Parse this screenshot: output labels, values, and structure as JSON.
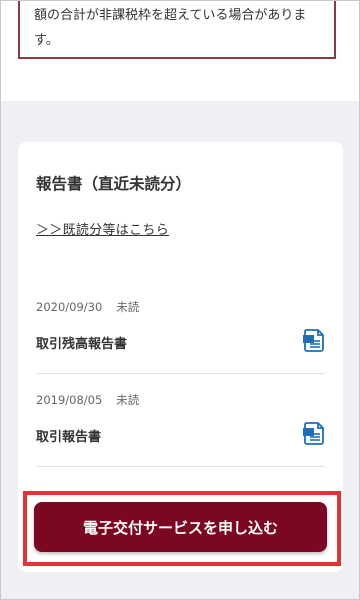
{
  "notice": {
    "line1": "額の合計が非課税枠を超えている場合がありま",
    "line2": "す。"
  },
  "reports_card": {
    "title": "報告書（直近未読分）",
    "archive_link": "＞＞既読分等はこちら",
    "items": [
      {
        "date": "2020/09/30",
        "status": "未読",
        "name": "取引残高報告書",
        "icon": "document-icon"
      },
      {
        "date": "2019/08/05",
        "status": "未読",
        "name": "取引報告書",
        "icon": "document-icon"
      }
    ]
  },
  "apply_button": {
    "label": "電子交付サービスを申し込む"
  },
  "colors": {
    "accent": "#7b0820",
    "highlight": "#e43333",
    "icon": "#1f6fb6",
    "warning_border": "#8a3a45"
  }
}
